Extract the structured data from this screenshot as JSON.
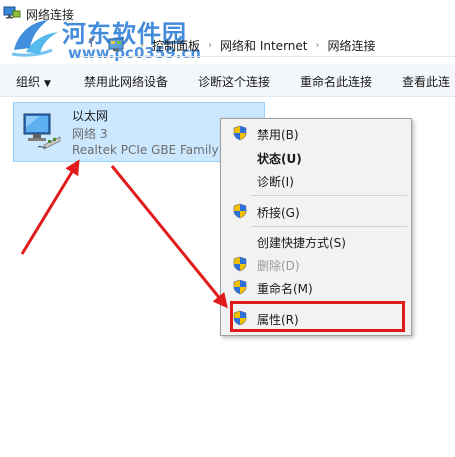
{
  "window": {
    "title": "网络连接"
  },
  "watermark": {
    "site_name": "河东软件园",
    "url": "www.pc0359.cn"
  },
  "address": {
    "breadcrumbs": [
      "控制面板",
      "网络和 Internet",
      "网络连接"
    ]
  },
  "toolbar": {
    "organize": "组织",
    "disable_device": "禁用此网络设备",
    "diagnose": "诊断这个连接",
    "rename": "重命名此连接",
    "view_status": "查看此连"
  },
  "connection": {
    "name": "以太网",
    "network": "网络  3",
    "adapter": "Realtek PCIe GBE Family C"
  },
  "context_menu": {
    "disable": "禁用(B)",
    "status": "状态(U)",
    "diagnose": "诊断(I)",
    "bridge": "桥接(G)",
    "create_shortcut": "创建快捷方式(S)",
    "delete": "删除(D)",
    "rename": "重命名(M)",
    "properties": "属性(R)"
  },
  "colors": {
    "selection": "#cce8ff",
    "annotation_red": "#e11b1b",
    "watermark_blue": "#2f7fd8"
  },
  "icons": {
    "window": "network-connections-icon",
    "shield": "uac-shield-icon",
    "adapter": "ethernet-adapter-icon"
  }
}
